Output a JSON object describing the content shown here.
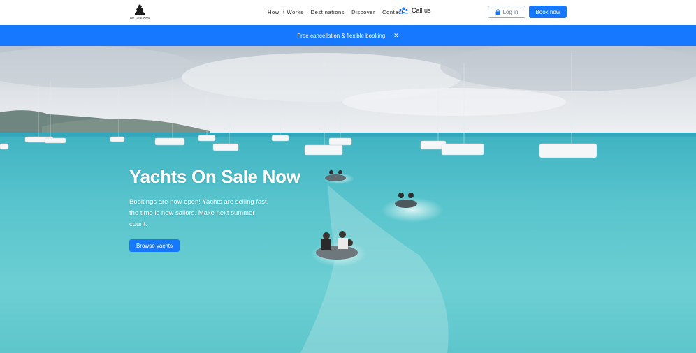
{
  "header": {
    "logo_text": "The Yacht Week",
    "nav": [
      "How It Works",
      "Destinations",
      "Discover",
      "Contact"
    ],
    "call_label": "Call us",
    "login_label": "Log in",
    "book_label": "Book now"
  },
  "banner": {
    "text": "Free cancellation & flexible booking",
    "close": "✕"
  },
  "hero": {
    "title": "Yachts On Sale Now",
    "description": "Bookings are now open! Yachts are selling fast, the time is now sailors. Make next summer count.",
    "cta_label": "Browse yachts"
  },
  "colors": {
    "accent": "#1677ff",
    "sea": "#5fc2c9",
    "sky": "#d7dde3"
  },
  "icons": [
    "yacht-week-logo-icon",
    "call-icon",
    "lock-icon",
    "close-icon"
  ]
}
